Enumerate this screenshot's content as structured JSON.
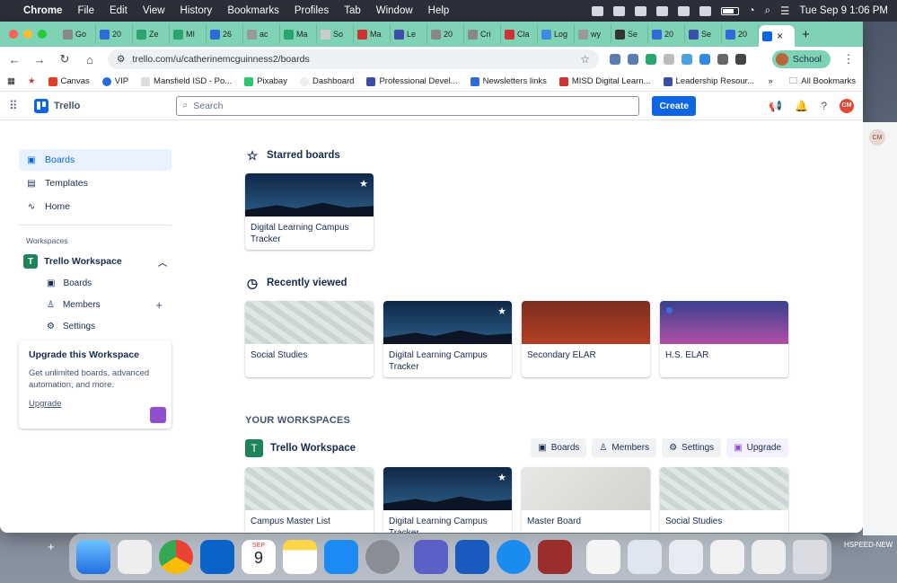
{
  "menubar": {
    "app_name": "Chrome",
    "items": [
      "File",
      "Edit",
      "View",
      "History",
      "Bookmarks",
      "Profiles",
      "Tab",
      "Window",
      "Help"
    ],
    "datetime": "Tue Sep 9  1:06 PM"
  },
  "browser": {
    "tabs": [
      "Go",
      "20",
      "Ze",
      "MI",
      "26",
      "ac",
      "Ma",
      "So",
      "Ma",
      "Le",
      "20",
      "Cri",
      "Cla",
      "Log",
      "wy",
      "Se",
      "20",
      "Se",
      "20"
    ],
    "url": "trello.com/u/catherinemcguinness2/boards",
    "profile_label": "School",
    "bookmarks": [
      "Canvas",
      "VIP",
      "Mansfield ISD - Po...",
      "Pixabay",
      "Dashboard",
      "Professional Devel...",
      "Newsletters links",
      "MISD Digital Learn...",
      "Leadership Resour..."
    ],
    "all_bookmarks": "All Bookmarks"
  },
  "trello": {
    "logo": "Trello",
    "search_placeholder": "Search",
    "create_label": "Create",
    "avatar_initials": "CM",
    "sidebar": {
      "nav": [
        "Boards",
        "Templates",
        "Home"
      ],
      "workspaces_label": "Workspaces",
      "workspace_name": "Trello Workspace",
      "workspace_badge": "T",
      "workspace_links": [
        "Boards",
        "Members",
        "Settings"
      ],
      "upgrade": {
        "title": "Upgrade this Workspace",
        "body": "Get unlimited boards, advanced automation, and more.",
        "link": "Upgrade"
      }
    },
    "starred": {
      "title": "Starred boards",
      "boards": [
        {
          "name": "Digital Learning Campus Tracker",
          "bg": "night"
        }
      ]
    },
    "recent": {
      "title": "Recently viewed",
      "boards": [
        {
          "name": "Social Studies",
          "bg": "map"
        },
        {
          "name": "Digital Learning Campus Tracker",
          "bg": "night"
        },
        {
          "name": "Secondary ELAR",
          "bg": "red"
        },
        {
          "name": "H.S. ELAR",
          "bg": "purple"
        }
      ]
    },
    "your_workspaces": {
      "title": "YOUR WORKSPACES",
      "workspace_name": "Trello Workspace",
      "actions": [
        "Boards",
        "Members",
        "Settings",
        "Upgrade"
      ],
      "boards": [
        {
          "name": "Campus Master List",
          "bg": "map"
        },
        {
          "name": "Digital Learning Campus Tracker",
          "bg": "night"
        },
        {
          "name": "Master Board",
          "bg": "ribbon"
        },
        {
          "name": "Social Studies",
          "bg": "map"
        }
      ]
    }
  },
  "dock": {
    "calendar_month": "SEP",
    "calendar_day": "9"
  },
  "background": {
    "avatar": "CM",
    "edge_text": "HSPEED-NEW"
  }
}
